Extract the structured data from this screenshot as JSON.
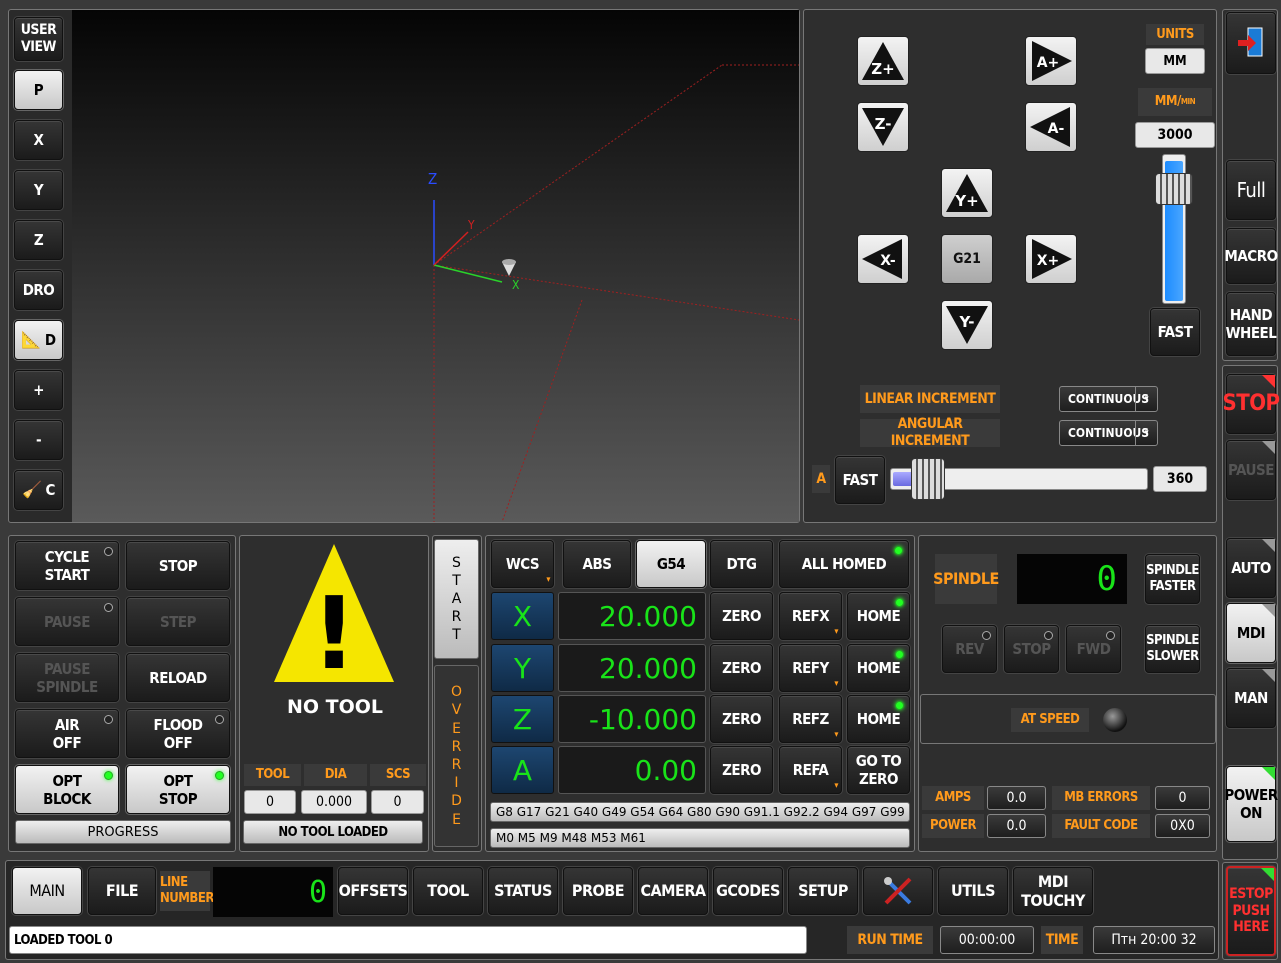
{
  "left_toolbar": {
    "user_view": "USER\nVIEW",
    "p": "P",
    "x": "X",
    "y": "Y",
    "z": "Z",
    "dro": "DRO",
    "d": "D",
    "plus": "+",
    "minus": "-",
    "c": "C"
  },
  "viewport": {
    "axis_z": "Z",
    "axis_y": "Y",
    "axis_x": "X"
  },
  "jog": {
    "z_plus": "Z+",
    "z_minus": "Z-",
    "a_plus": "A+",
    "a_minus": "A-",
    "y_plus": "Y+",
    "y_minus": "Y-",
    "x_plus": "X+",
    "x_minus": "X-",
    "g21": "G21",
    "units_label": "UNITS",
    "units_value": "MM",
    "rate_label": "MM/",
    "rate_sup": "MIN",
    "rate_value": "3000",
    "rate_slider_fraction": 0.97,
    "fast": "FAST",
    "linear_increment": "LINEAR INCREMENT",
    "linear_value": "CONTINUOUS",
    "angular_increment": "ANGULAR INCREMENT",
    "angular_value": "CONTINUOUS",
    "a_label": "A",
    "a_fast": "FAST",
    "a_value": "360",
    "a_slider_fraction": 0.04
  },
  "right_column": {
    "exit_icon": "exit-icon",
    "full": "Full",
    "macro": "MACRO",
    "handwheel": "HAND\nWHEEL",
    "stop": "STOP",
    "pause": "PAUSE",
    "auto": "AUTO",
    "mdi": "MDI",
    "man": "MAN",
    "power": "POWER\nON",
    "estop": "ESTOP\nPUSH\nHERE"
  },
  "cycle": {
    "cycle_start": "CYCLE\nSTART",
    "stop": "STOP",
    "pause": "PAUSE",
    "step": "STEP",
    "pause_spindle": "PAUSE\nSPINDLE",
    "reload": "RELOAD",
    "air": "AIR\nOFF",
    "flood": "FLOOD\nOFF",
    "opt_block": "OPT\nBLOCK",
    "opt_stop": "OPT\nSTOP",
    "progress": "PROGRESS"
  },
  "tool": {
    "warning": "!",
    "no_tool": "NO TOOL",
    "tool_label": "TOOL",
    "dia_label": "DIA",
    "scs_label": "SCS",
    "tool_value": "0",
    "dia_value": "0.000",
    "scs_value": "0",
    "status": "NO TOOL LOADED"
  },
  "override": {
    "start": "S\nT\nA\nR\nT",
    "override": "O\nV\nE\nR\nR\nI\nD\nE"
  },
  "dro": {
    "wcs": "WCS",
    "abs": "ABS",
    "g54": "G54",
    "dtg": "DTG",
    "all_homed": "ALL HOMED",
    "rows": [
      {
        "axis": "X",
        "value": "20.000",
        "zero": "ZERO",
        "ref": "REFX",
        "home": "HOME"
      },
      {
        "axis": "Y",
        "value": "20.000",
        "zero": "ZERO",
        "ref": "REFY",
        "home": "HOME"
      },
      {
        "axis": "Z",
        "value": "-10.000",
        "zero": "ZERO",
        "ref": "REFZ",
        "home": "HOME"
      },
      {
        "axis": "A",
        "value": "0.00",
        "zero": "ZERO",
        "ref": "REFA",
        "home": "GO TO\nZERO"
      }
    ],
    "gcodes": "G8 G17 G21 G40 G49 G54 G64 G80 G90 G91.1 G92.2 G94 G97 G99",
    "mcodes": "M0 M5 M9 M48 M53 M61"
  },
  "spindle": {
    "label": "SPINDLE",
    "value": "0",
    "faster": "SPINDLE\nFASTER",
    "slower": "SPINDLE\nSLOWER",
    "rev": "REV",
    "stop": "STOP",
    "fwd": "FWD",
    "at_speed": "AT SPEED",
    "amps_label": "AMPS",
    "amps_value": "0.0",
    "mb_errors_label": "MB ERRORS",
    "mb_errors_value": "0",
    "power_label": "POWER",
    "power_value": "0.0",
    "fault_label": "FAULT CODE",
    "fault_value": "0X0"
  },
  "tabs": {
    "main": "MAIN",
    "file": "FILE",
    "line_number": "LINE\nNUMBER",
    "line_value": "0",
    "offsets": "OFFSETS",
    "tool": "TOOL",
    "status": "STATUS",
    "probe": "PROBE",
    "camera": "CAMERA",
    "gcodes": "GCODES",
    "setup": "SETUP",
    "utils": "UTILS",
    "mdi_touchy": "MDI\nTOUCHY"
  },
  "status_bar": {
    "message": "LOADED TOOL 0",
    "run_time_label": "RUN TIME",
    "run_time": "00:00:00",
    "time_label": "TIME",
    "time": "Птн 20:00 32"
  }
}
